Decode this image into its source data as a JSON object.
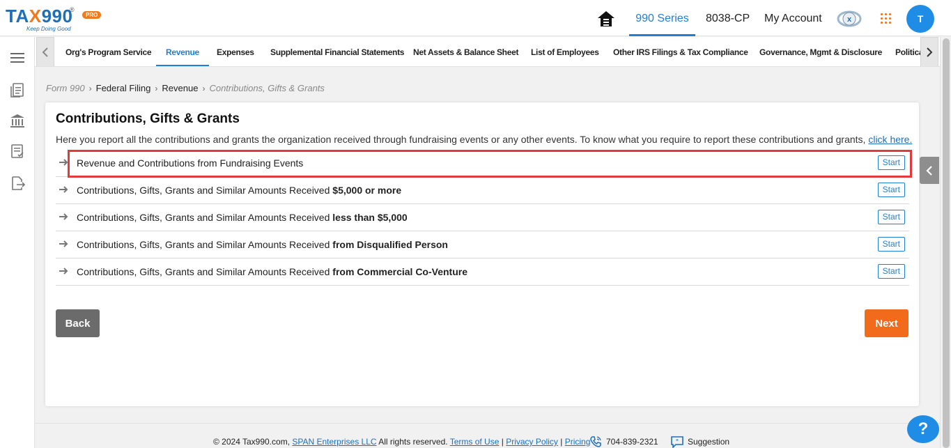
{
  "header": {
    "logo_text_a": "TA",
    "logo_text_x": "X",
    "logo_text_b": "990",
    "logo_reg": "®",
    "logo_badge": "PRO",
    "logo_tagline": "Keep Doing Good",
    "nav": [
      {
        "label": "990 Series",
        "active": true
      },
      {
        "label": "8038-CP",
        "active": false
      },
      {
        "label": "My Account",
        "active": false
      }
    ],
    "avatar_initial": "T"
  },
  "tabs": [
    {
      "label": "Org's Program Service"
    },
    {
      "label": "Revenue",
      "active": true
    },
    {
      "label": "Expenses"
    },
    {
      "label": "Supplemental Financial Statements"
    },
    {
      "label": "Net Assets & Balance Sheet"
    },
    {
      "label": "List of Employees"
    },
    {
      "label": "Other IRS Filings & Tax Compliance"
    },
    {
      "label": "Governance, Mgmt & Disclosure"
    },
    {
      "label": "Politica"
    }
  ],
  "breadcrumb": {
    "item1": "Form 990",
    "item2": "Federal Filing",
    "item3": "Revenue",
    "current": "Contributions, Gifts & Grants"
  },
  "card": {
    "title": "Contributions, Gifts & Grants",
    "description": "Here you report all the contributions and grants the organization received through fundraising events or any other events. To know what you require to report these contributions and grants,",
    "description_link": "click here.",
    "rows": [
      {
        "text": "Revenue and Contributions from Fundraising Events",
        "bold": "",
        "button": "Start"
      },
      {
        "text": "Contributions, Gifts, Grants and Similar Amounts Received ",
        "bold": "$5,000 or more",
        "button": "Start"
      },
      {
        "text": "Contributions, Gifts, Grants and Similar Amounts Received ",
        "bold": "less than $5,000",
        "button": "Start"
      },
      {
        "text": "Contributions, Gifts, Grants and Similar Amounts Received ",
        "bold": "from Disqualified Person",
        "button": "Start"
      },
      {
        "text": "Contributions, Gifts, Grants and Similar Amounts Received ",
        "bold": "from Commercial Co-Venture",
        "button": "Start"
      }
    ],
    "back_label": "Back",
    "next_label": "Next"
  },
  "footer": {
    "copyright": "© 2024 Tax990.com,",
    "company_link": "SPAN Enterprises LLC",
    "rights": "All rights reserved.",
    "terms": "Terms of Use",
    "privacy": "Privacy Policy",
    "pricing": "Pricing",
    "sep": "|",
    "phone": "704-839-2321",
    "suggestion": "Suggestion"
  },
  "help_label": "?",
  "colors": {
    "brand_blue": "#1f7fd6",
    "brand_orange": "#f26a1b",
    "highlight_red": "#e0393e"
  }
}
